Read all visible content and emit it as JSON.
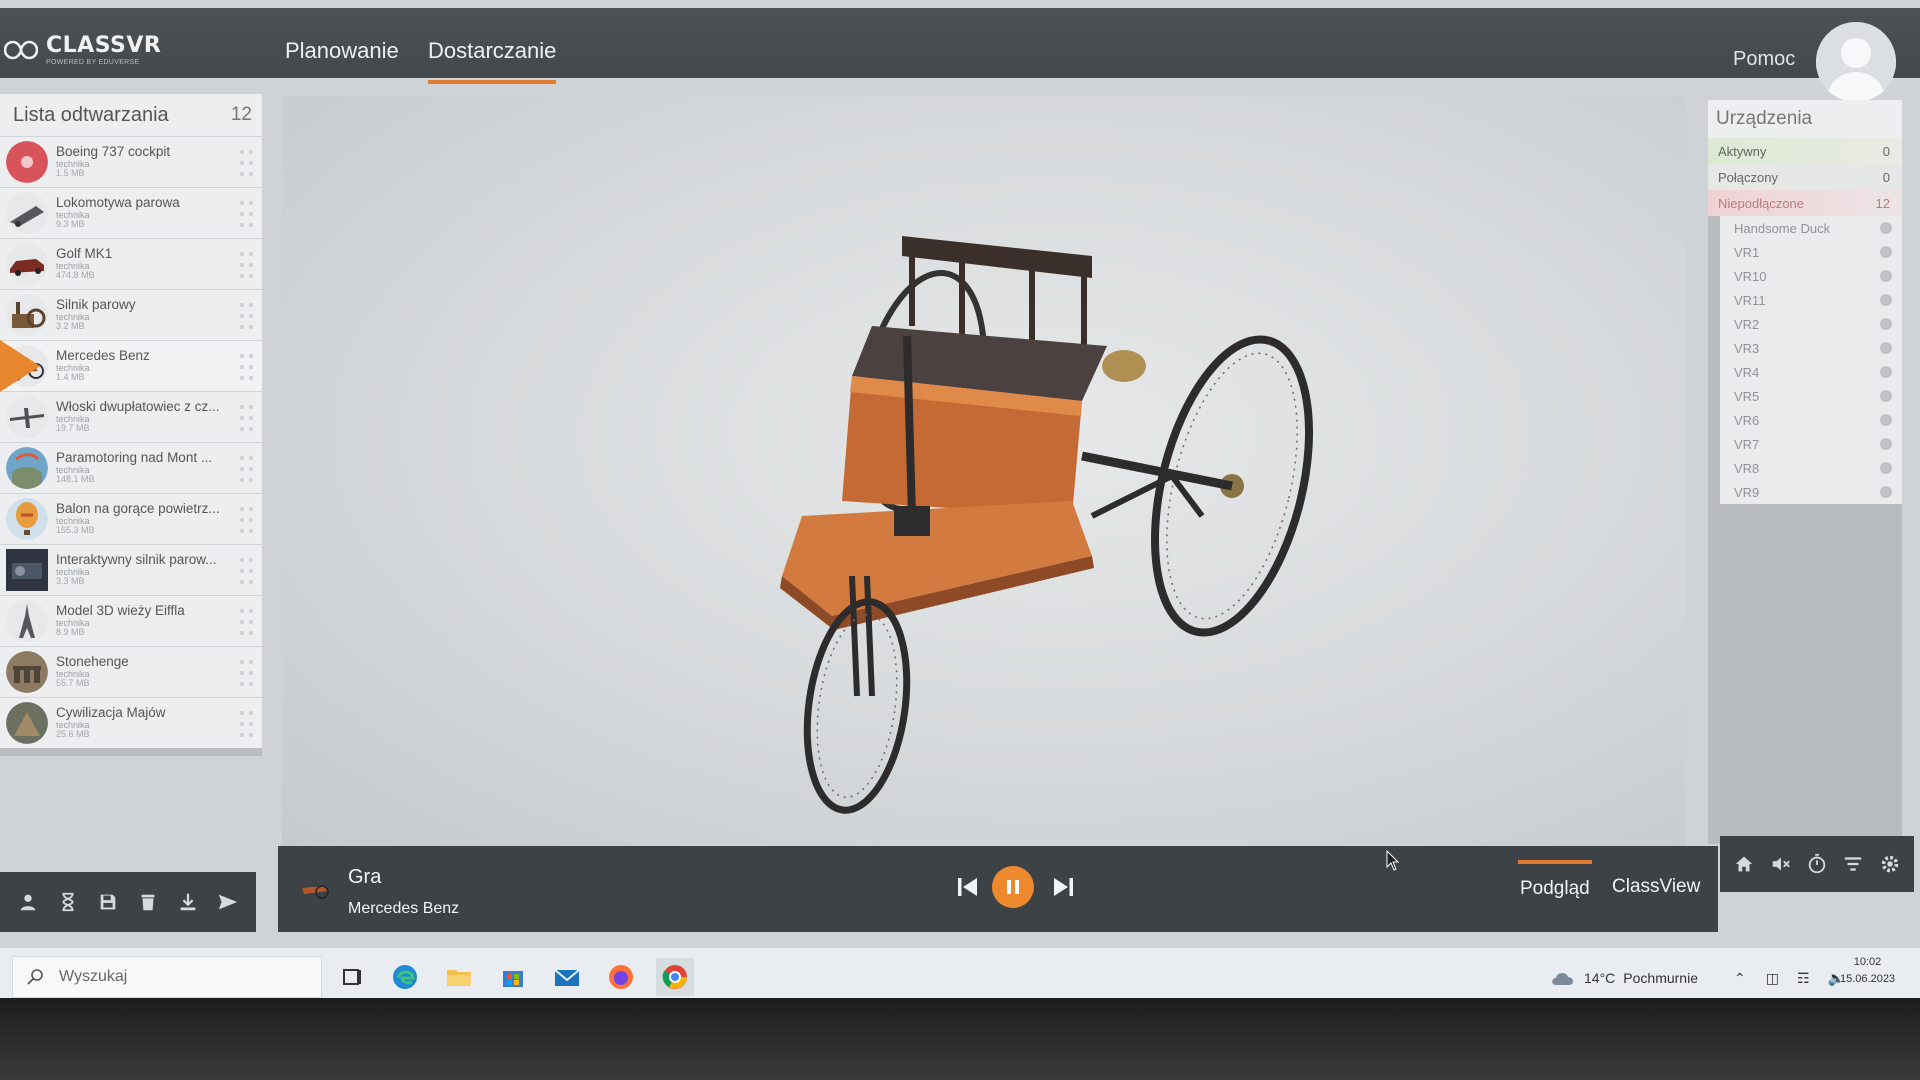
{
  "app": {
    "brand": "CLASSVR",
    "brand_tagline": "POWERED BY EDUVERSE"
  },
  "nav": {
    "tabs": [
      "Planowanie",
      "Dostarczanie"
    ],
    "active_tab": "Dostarczanie",
    "help_label": "Pomoc"
  },
  "playlist": {
    "title": "Lista odtwarzania",
    "count": "12",
    "active_index": 4,
    "items": [
      {
        "name": "Boeing 737 cockpit",
        "category": "technika",
        "size": "1.5 MB",
        "thumb": "cockpit-thumb"
      },
      {
        "name": "Lokomotywa parowa",
        "category": "technika",
        "size": "9.3 MB",
        "thumb": "locomotive-thumb"
      },
      {
        "name": "Golf MK1",
        "category": "technika",
        "size": "474.8 MB",
        "thumb": "car-thumb"
      },
      {
        "name": "Silnik parowy",
        "category": "technika",
        "size": "3.2 MB",
        "thumb": "steam-engine-thumb"
      },
      {
        "name": "Mercedes Benz",
        "category": "technika",
        "size": "1.4 MB",
        "thumb": "motorwagen-thumb"
      },
      {
        "name": "Włoski dwupłatowiec z cz...",
        "category": "technika",
        "size": "19.7 MB",
        "thumb": "biplane-thumb"
      },
      {
        "name": "Paramotoring nad Mont ...",
        "category": "technika",
        "size": "148.1 MB",
        "thumb": "paramotor-thumb"
      },
      {
        "name": "Balon na gorące powietrz...",
        "category": "technika",
        "size": "155.3 MB",
        "thumb": "balloon-thumb"
      },
      {
        "name": "Interaktywny silnik parow...",
        "category": "technika",
        "size": "3.3 MB",
        "thumb": "interactive-engine-thumb"
      },
      {
        "name": "Model 3D wieży Eiffla",
        "category": "technika",
        "size": "8.9 MB",
        "thumb": "eiffel-thumb"
      },
      {
        "name": "Stonehenge",
        "category": "technika",
        "size": "55.7 MB",
        "thumb": "stonehenge-thumb"
      },
      {
        "name": "Cywilizacja Majów",
        "category": "technika",
        "size": "25.6 MB",
        "thumb": "maya-thumb"
      }
    ]
  },
  "player": {
    "mode": "Gra",
    "title": "Mercedes Benz",
    "state": "playing",
    "views": [
      "Podgląd",
      "ClassView"
    ],
    "active_view": "Podgląd"
  },
  "devices": {
    "title": "Urządzenia",
    "statuses": [
      {
        "label": "Aktywny",
        "count": "0",
        "color": "#d9e8cf"
      },
      {
        "label": "Połączony",
        "count": "0",
        "color": "#e6e8e8"
      },
      {
        "label": "Niepodłączone",
        "count": "12",
        "color": "#f1d2d4"
      }
    ],
    "list": [
      "Handsome Duck",
      "VR1",
      "VR10",
      "VR11",
      "VR2",
      "VR3",
      "VR4",
      "VR5",
      "VR6",
      "VR7",
      "VR8",
      "VR9"
    ]
  },
  "taskbar": {
    "search_placeholder": "Wyszukaj",
    "apps": [
      "task-view-icon",
      "edge-icon",
      "file-explorer-icon",
      "store-icon",
      "mail-icon",
      "firefox-icon",
      "chrome-icon"
    ],
    "weather_temp": "14°C",
    "weather_desc": "Pochmurnie",
    "time": "10:02",
    "date": "15.06.2023"
  },
  "colors": {
    "accent": "#e07a2f",
    "topbar": "#45494d",
    "dark_bar": "#3d4246"
  }
}
